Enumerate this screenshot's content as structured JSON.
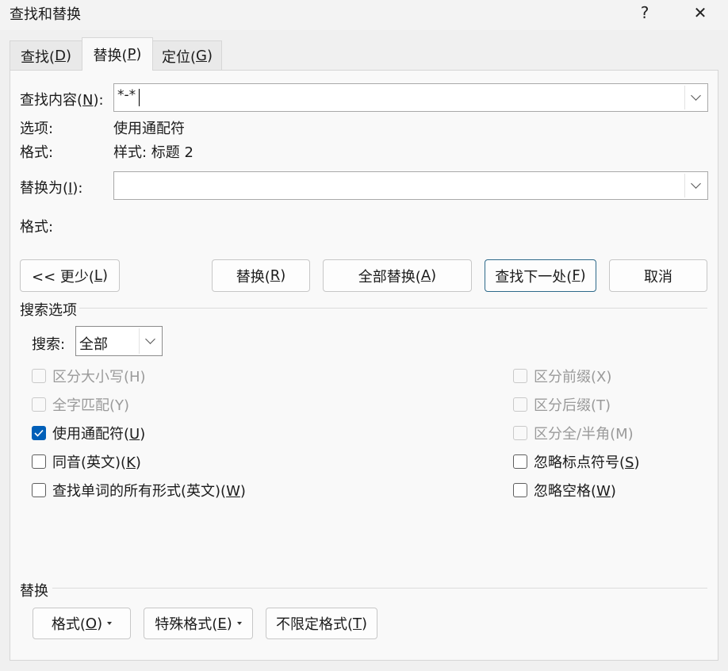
{
  "window": {
    "title": "查找和替换",
    "help": "?",
    "close": "✕"
  },
  "tabs": [
    {
      "pre": "查找(",
      "key": "D",
      "post": ")"
    },
    {
      "pre": "替换(",
      "key": "P",
      "post": ")"
    },
    {
      "pre": "定位(",
      "key": "G",
      "post": ")"
    }
  ],
  "find": {
    "label_pre": "查找内容(",
    "label_key": "N",
    "label_post": "):",
    "value": "*-*"
  },
  "options": {
    "label": "选项:",
    "value": "使用通配符"
  },
  "find_format": {
    "label": "格式:",
    "value": "样式: 标题 2"
  },
  "replace": {
    "label_pre": "替换为(",
    "label_key": "I",
    "label_post": "):",
    "value": ""
  },
  "replace_format": {
    "label": "格式:"
  },
  "buttons": {
    "less": {
      "pre": "<< 更少(",
      "key": "L",
      "post": ")"
    },
    "replace": {
      "pre": "替换(",
      "key": "R",
      "post": ")"
    },
    "replace_all": {
      "pre": "全部替换(",
      "key": "A",
      "post": ")"
    },
    "find_next": {
      "pre": "查找下一处(",
      "key": "F",
      "post": ")"
    },
    "cancel": "取消"
  },
  "search_options": {
    "title": "搜索选项",
    "search_label": "搜索:",
    "search_value": "全部"
  },
  "checkboxes_left": [
    {
      "pre": "区分大小写(H)",
      "key": "",
      "post": "",
      "checked": false,
      "disabled": true
    },
    {
      "pre": "全字匹配(Y)",
      "key": "",
      "post": "",
      "checked": false,
      "disabled": true
    },
    {
      "pre": "使用通配符(",
      "key": "U",
      "post": ")",
      "checked": true,
      "disabled": false
    },
    {
      "pre": "同音(英文)(",
      "key": "K",
      "post": ")",
      "checked": false,
      "disabled": false
    },
    {
      "pre": "查找单词的所有形式(英文)(",
      "key": "W",
      "post": ")",
      "checked": false,
      "disabled": false
    }
  ],
  "checkboxes_right": [
    {
      "pre": "区分前缀(X)",
      "key": "",
      "post": "",
      "checked": false,
      "disabled": true
    },
    {
      "pre": "区分后缀(T)",
      "key": "",
      "post": "",
      "checked": false,
      "disabled": true
    },
    {
      "pre": "区分全/半角(M)",
      "key": "",
      "post": "",
      "checked": false,
      "disabled": true
    },
    {
      "pre": "忽略标点符号(",
      "key": "S",
      "post": ")",
      "checked": false,
      "disabled": false
    },
    {
      "pre": "忽略空格(",
      "key": "W",
      "post": ")",
      "checked": false,
      "disabled": false
    }
  ],
  "replace_section": {
    "title": "替换",
    "format_btn": {
      "pre": "格式(",
      "key": "O",
      "post": ")"
    },
    "special_btn": {
      "pre": "特殊格式(",
      "key": "E",
      "post": ")"
    },
    "no_format_btn": {
      "pre": "不限定格式(",
      "key": "T",
      "post": ")"
    }
  }
}
